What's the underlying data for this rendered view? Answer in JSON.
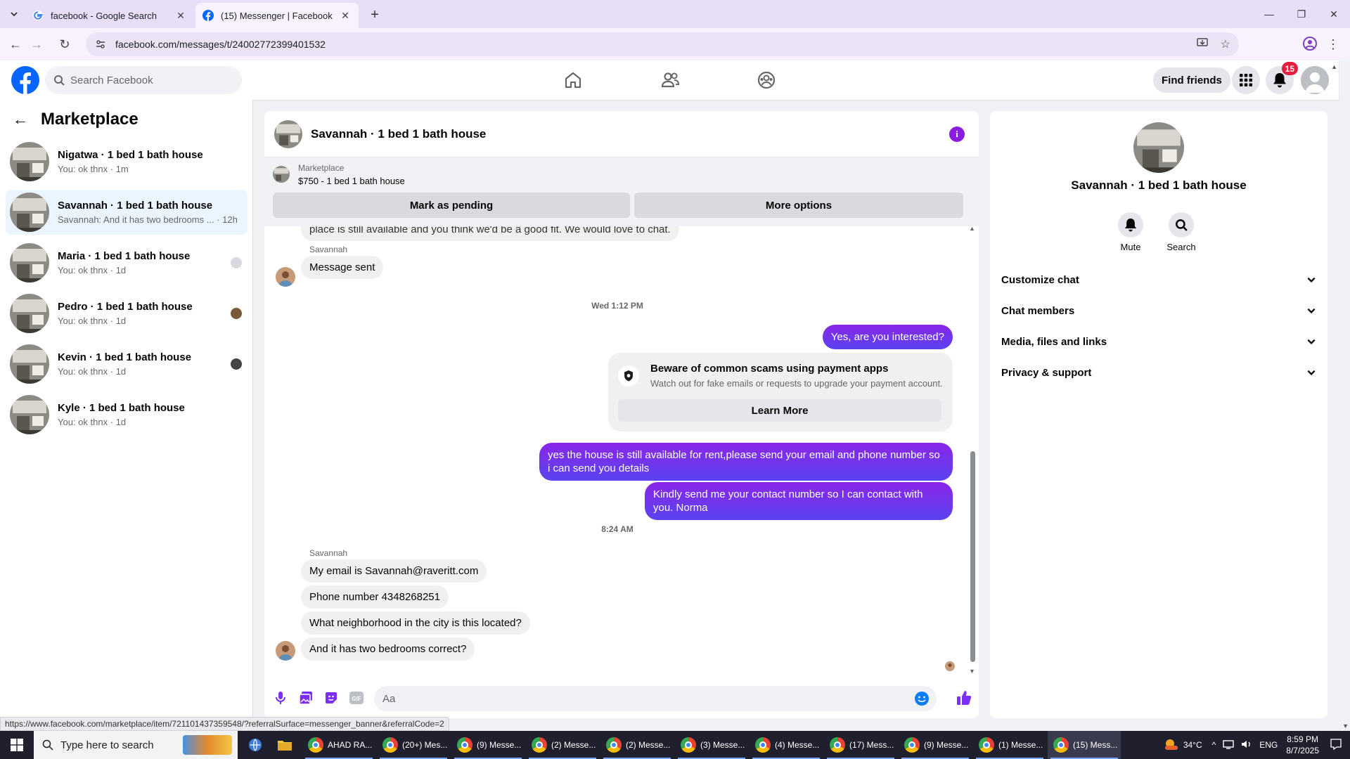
{
  "browser": {
    "tabs": [
      {
        "title": "facebook - Google Search",
        "active": false
      },
      {
        "title": "(15) Messenger | Facebook",
        "active": true
      }
    ],
    "url": "facebook.com/messages/t/24002772399401532",
    "status_url": "https://www.facebook.com/marketplace/item/721101437359548/?referralSurface=messenger_banner&referralCode=2"
  },
  "fb": {
    "search_placeholder": "Search Facebook",
    "find_friends": "Find friends",
    "notification_count": "15",
    "brand_color": "#0866ff"
  },
  "sidebar": {
    "title": "Marketplace",
    "conversations": [
      {
        "name": "Nigatwa · 1 bed 1 bath house",
        "preview": "You: ok thnx · 1m"
      },
      {
        "name": "Savannah · 1 bed 1 bath house",
        "preview": "Savannah: And it has two bedrooms ... · 12h",
        "active": true
      },
      {
        "name": "Maria · 1 bed 1 bath house",
        "preview": "You: ok thnx · 1d"
      },
      {
        "name": "Pedro · 1 bed 1 bath house",
        "preview": "You: ok thnx · 1d"
      },
      {
        "name": "Kevin · 1 bed 1 bath house",
        "preview": "You: ok thnx · 1d"
      },
      {
        "name": "Kyle · 1 bed 1 bath house",
        "preview": "You: ok thnx · 1d"
      }
    ]
  },
  "chat": {
    "title": "Savannah · 1 bed 1 bath house",
    "banner": {
      "label": "Marketplace",
      "listing": "$750 - 1 bed 1 bath house",
      "mark_pending": "Mark as pending",
      "more_options": "More options"
    },
    "partial_message": "place is still available and you think we'd be a good fit. We would love to chat.",
    "messages": {
      "sender_1": "Savannah",
      "msg_sent": "Message sent",
      "time_1": "Wed 1:12 PM",
      "out_1": "Yes, are you interested?",
      "scam_title": "Beware of common scams using payment apps",
      "scam_desc": "Watch out for fake emails or requests to upgrade your payment account.",
      "learn_more": "Learn More",
      "out_2": "yes the house is still available for rent,please send your email and phone number so i can send you details",
      "out_3": "Kindly send me your contact number so I can contact with you. Norma",
      "time_2": "8:24 AM",
      "sender_2": "Savannah",
      "in_1": "My email is Savannah@raveritt.com",
      "in_2": "Phone number 4348268251",
      "in_3": "What neighborhood in the city is this located?",
      "in_4": "And it has two bedrooms correct?"
    },
    "composer_placeholder": "Aa",
    "accent": "#7b2ff7"
  },
  "info_panel": {
    "name": "Savannah · 1 bed 1 bath house",
    "mute": "Mute",
    "search": "Search",
    "rows": [
      "Customize chat",
      "Chat members",
      "Media, files and links",
      "Privacy & support"
    ]
  },
  "taskbar": {
    "search_placeholder": "Type here to search",
    "apps": [
      "AHAD RA...",
      "(20+) Mes...",
      "(9) Messe...",
      "(2) Messe...",
      "(2) Messe...",
      "(3) Messe...",
      "(4) Messe...",
      "(17) Mess...",
      "(9) Messe...",
      "(1) Messe...",
      "(15) Mess..."
    ],
    "temperature": "34°C",
    "language": "ENG",
    "time": "8:59 PM",
    "date": "8/7/2025"
  }
}
